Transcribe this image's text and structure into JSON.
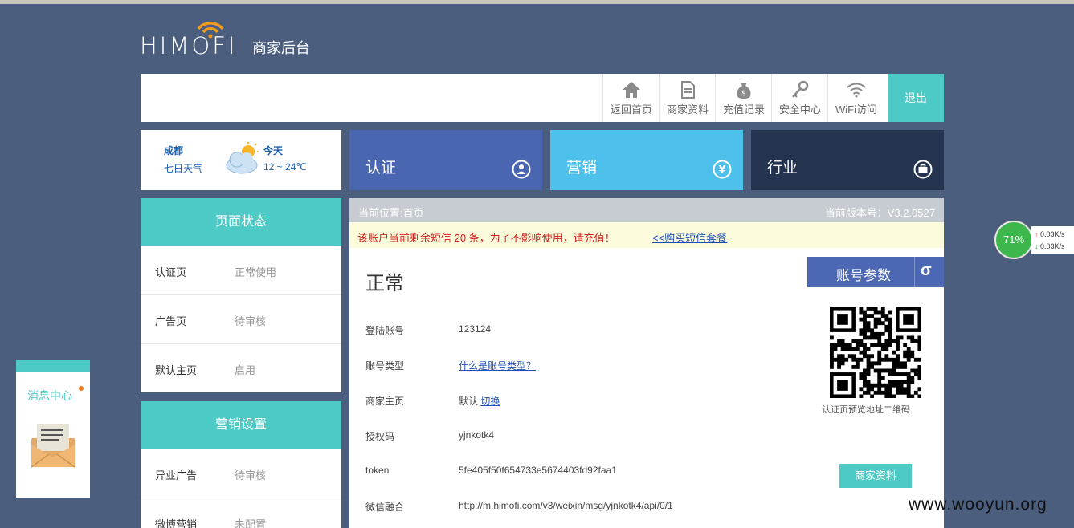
{
  "brand": {
    "logo": "HIMOFI",
    "subtitle": "商家后台"
  },
  "nav": {
    "items": [
      {
        "label": "返回首页",
        "icon": "home-icon"
      },
      {
        "label": "商家资料",
        "icon": "document-icon"
      },
      {
        "label": "充值记录",
        "icon": "money-bag-icon"
      },
      {
        "label": "安全中心",
        "icon": "key-icon"
      },
      {
        "label": "WiFi访问",
        "icon": "wifi-icon"
      }
    ],
    "logout": "退出"
  },
  "weather": {
    "city": "成都",
    "link": "七日天气",
    "day": "今天",
    "temp": "12 ~ 24℃",
    "icon": "sun-cloud-icon"
  },
  "tiles": [
    {
      "label": "认证",
      "color": "#4b66b0",
      "icon": "user-icon"
    },
    {
      "label": "营销",
      "color": "#4dc0ec",
      "icon": "yen-icon"
    },
    {
      "label": "行业",
      "color": "#24344f",
      "icon": "briefcase-icon"
    }
  ],
  "page_status": {
    "title": "页面状态",
    "rows": [
      {
        "k": "认证页",
        "v": "正常使用"
      },
      {
        "k": "广告页",
        "v": "待审核"
      },
      {
        "k": "默认主页",
        "v": "启用"
      }
    ]
  },
  "marketing": {
    "title": "营销设置",
    "rows": [
      {
        "k": "异业广告",
        "v": "待审核"
      },
      {
        "k": "微博营销",
        "v": "未配置"
      }
    ]
  },
  "breadcrumb": {
    "location": "当前位置:首页",
    "version": "当前版本号：V3.2.0527"
  },
  "notice": {
    "warning": "该账户当前剩余短信 20 条，为了不影响使用，请充值！",
    "link": "<<购买短信套餐"
  },
  "status": "正常",
  "account": {
    "login": {
      "k": "登陆账号",
      "v": "123124"
    },
    "type": {
      "k": "账号类型",
      "v": "什么是账号类型？"
    },
    "home": {
      "k": "商家主页",
      "v": "默认",
      "link": "切换"
    },
    "auth": {
      "k": "授权码",
      "v": "yjnkotk4"
    },
    "token": {
      "k": "token",
      "v": "5fe405f50f654733e5674403fd92faa1"
    },
    "weixin": {
      "k": "微信融合",
      "v": "http://m.himofi.com/v3/weixin/msg/yjnkotk4/api/0/1"
    }
  },
  "account_params": {
    "label": "账号参数",
    "symbol": "σ"
  },
  "qr_caption": "认证页预览地址二维码",
  "biz_button": "商家资料",
  "message_center": "消息中心",
  "net_monitor": {
    "percent": "71%",
    "up": "0.03K/s",
    "down": "0.03K/s"
  },
  "watermark": "www.wooyun.org"
}
